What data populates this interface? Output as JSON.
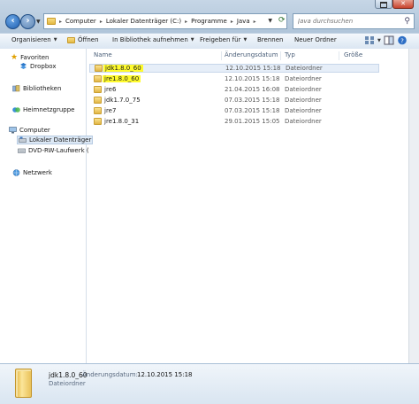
{
  "window": {
    "close_glyph": "✕"
  },
  "address": {
    "crumbs": [
      "Computer",
      "Lokaler Datenträger (C:)",
      "Programme",
      "Java"
    ],
    "search_placeholder": "Java durchsuchen"
  },
  "toolbar": {
    "organize": "Organisieren",
    "open": "Öffnen",
    "include_library": "In Bibliothek aufnehmen",
    "share": "Freigeben für",
    "burn": "Brennen",
    "new_folder": "Neuer Ordner"
  },
  "sidebar": {
    "favorites": "Favoriten",
    "dropbox": "Dropbox",
    "libraries": "Bibliotheken",
    "homegroup": "Heimnetzgruppe",
    "computer": "Computer",
    "local_disk": "Lokaler Datenträger",
    "dvd": "DVD-RW-Laufwerk (",
    "network": "Netzwerk"
  },
  "columns": {
    "name": "Name",
    "date": "Änderungsdatum",
    "type": "Typ",
    "size": "Größe"
  },
  "files": [
    {
      "name": "jdk1.8.0_60",
      "date": "12.10.2015 15:18",
      "type": "Dateiordner",
      "highlighted": true,
      "selected": true
    },
    {
      "name": "jre1.8.0_60",
      "date": "12.10.2015 15:18",
      "type": "Dateiordner",
      "highlighted": true,
      "selected": false
    },
    {
      "name": "jre6",
      "date": "21.04.2015 16:08",
      "type": "Dateiordner",
      "highlighted": false,
      "selected": false
    },
    {
      "name": "jdk1.7.0_75",
      "date": "07.03.2015 15:18",
      "type": "Dateiordner",
      "highlighted": false,
      "selected": false
    },
    {
      "name": "jre7",
      "date": "07.03.2015 15:18",
      "type": "Dateiordner",
      "highlighted": false,
      "selected": false
    },
    {
      "name": "jre1.8.0_31",
      "date": "29.01.2015 15:05",
      "type": "Dateiordner",
      "highlighted": false,
      "selected": false
    }
  ],
  "details": {
    "name": "jdk1.8.0_60",
    "date_label": "Änderungsdatum:",
    "date": "12.10.2015 15:18",
    "type": "Dateiordner"
  },
  "colors": {
    "highlight": "#fffb2e",
    "folder": "#e2b545",
    "selection": "#e6eef8"
  }
}
